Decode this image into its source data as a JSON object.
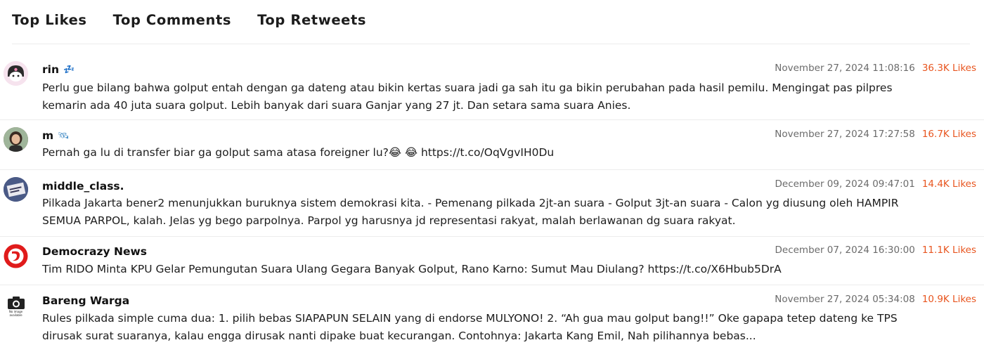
{
  "tabs": [
    "Top Likes",
    "Top Comments",
    "Top Retweets"
  ],
  "posts": [
    {
      "name": "rin",
      "badge": "💤",
      "date": "November 27, 2024 11:08:16",
      "likes": "36.3K Likes",
      "text_lines": [
        "Perlu gue bilang bahwa golput entah dengan ga dateng atau bikin kertas suara jadi ga sah itu ga bikin perubahan pada hasil pemilu. Mengingat pas pilpres",
        "kemarin ada 40 juta suara golput. Lebih banyak dari suara Ganjar yang 27 jt. Dan setara sama suara Anies."
      ],
      "avatar_color": "#f3d7e6"
    },
    {
      "name": "m",
      "badge": "🛰",
      "date": "November 27, 2024 17:27:58",
      "likes": "16.7K Likes",
      "text_lines": [
        "Pernah ga lu di transfer biar ga golput sama atasa foreigner lu?😂 😂 https://t.co/OqVgvIH0Du"
      ],
      "avatar_color": "#6f5a4b"
    },
    {
      "name": "middle_class.",
      "badge": "",
      "date": "December 09, 2024 09:47:01",
      "likes": "14.4K Likes",
      "text_lines": [
        "Pilkada Jakarta bener2 menunjukkan buruknya sistem demokrasi kita. - Pemenang pilkada 2jt-an suara - Golput 3jt-an suara - Calon yg diusung oleh HAMPIR",
        "SEMUA PARPOL, kalah. Jelas yg bego parpolnya. Parpol yg harusnya jd representasi rakyat, malah berlawanan dg suara rakyat."
      ],
      "avatar_color": "#3f4f7a"
    },
    {
      "name": "Democrazy News",
      "badge": "",
      "date": "December 07, 2024 16:30:00",
      "likes": "11.1K Likes",
      "text_lines": [
        "Tim RIDO Minta KPU Gelar Pemungutan Suara Ulang Gegara Banyak Golput, Rano Karno: Sumut Mau Diulang? https://t.co/X6Hbub5DrA"
      ],
      "avatar_color": "#e01b1b"
    },
    {
      "name": "Bareng Warga",
      "badge": "",
      "date": "November 27, 2024 05:34:08",
      "likes": "10.9K Likes",
      "text_lines": [
        "Rules pilkada simple cuma dua: 1. pilih bebas SIAPAPUN SELAIN yang di endorse MULYONO! 2. “Ah gua mau golput bang!!” Oke gapapa tetep dateng ke TPS",
        "dirusak surat suaranya, kalau engga dirusak nanti dipake buat kecurangan. Contohnya: Jakarta Kang Emil, Nah pilihannya bebas..."
      ],
      "avatar_color": "#222222",
      "avatar_caption": "No image available"
    }
  ]
}
